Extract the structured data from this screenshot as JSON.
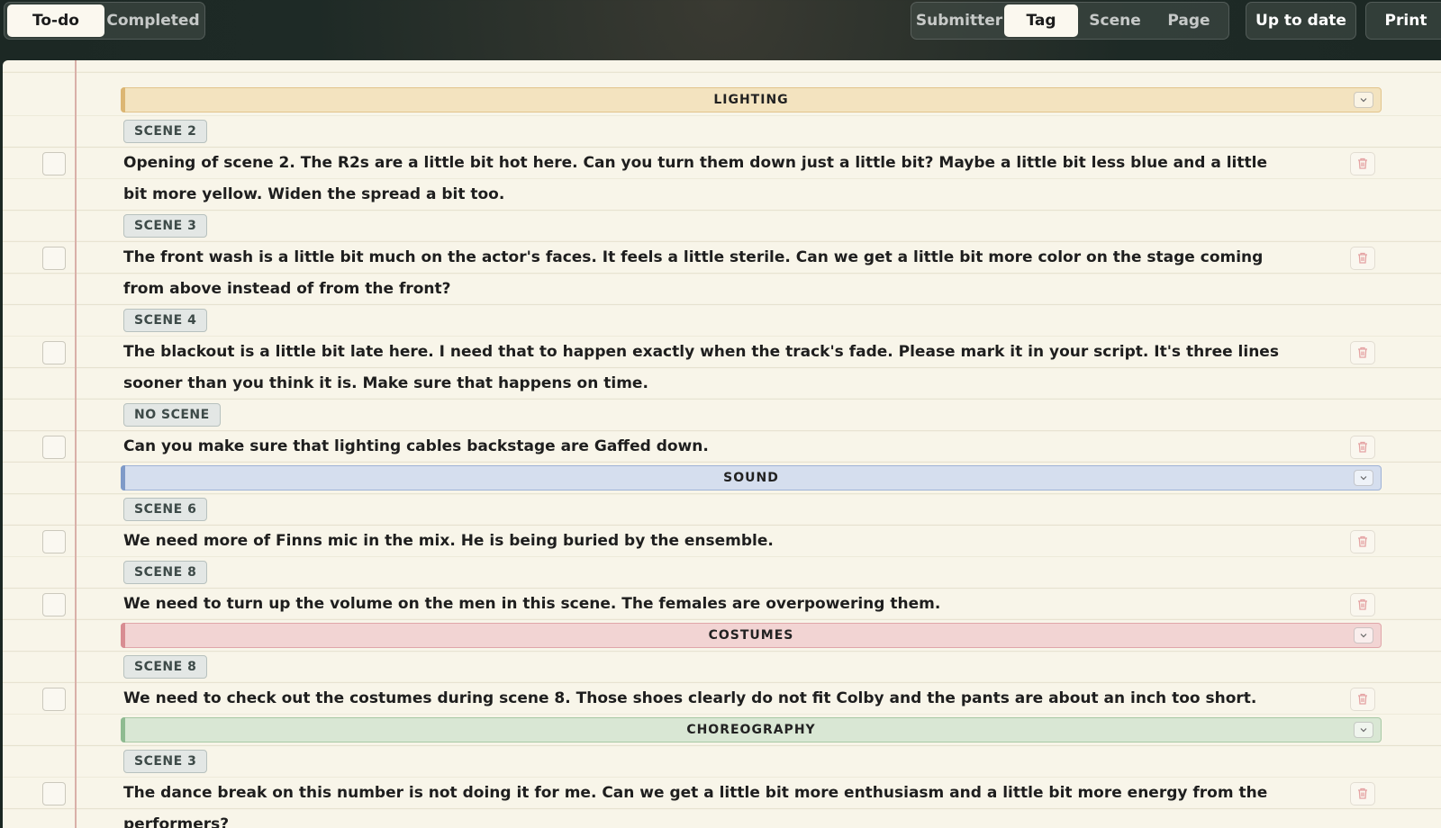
{
  "view_tabs": [
    {
      "label": "To-do",
      "active": true
    },
    {
      "label": "Completed",
      "active": false
    }
  ],
  "group_by": [
    {
      "label": "Submitter",
      "active": false
    },
    {
      "label": "Tag",
      "active": true
    },
    {
      "label": "Scene",
      "active": false
    },
    {
      "label": "Page",
      "active": false
    }
  ],
  "actions": {
    "up_to_date": "Up to date",
    "print": "Print"
  },
  "icons": {
    "collapse": "chevron-down-icon",
    "delete": "trash-icon"
  },
  "groups": [
    {
      "tag": "LIGHTING",
      "bar_color": "#dcb673",
      "bg_color": "#f3e3bf",
      "border_color": "#e2c48c",
      "scenes": [
        {
          "scene": "SCENE 2",
          "notes": [
            "Opening of scene 2. The R2s are a little bit hot here. Can you turn them down just a little bit? Maybe a little bit less blue and a little bit more yellow. Widen the spread a bit too."
          ]
        },
        {
          "scene": "SCENE 3",
          "notes": [
            "The front wash is a little bit much on the actor's faces. It feels a little sterile. Can we get a little bit more color on the stage coming from above instead of from the front?"
          ]
        },
        {
          "scene": "SCENE 4",
          "notes": [
            "The blackout is a little bit late here. I need that to happen exactly when the track's fade. Please mark it in your script. It's three lines sooner than you think it is. Make sure that happens on time."
          ]
        },
        {
          "scene": "NO SCENE",
          "notes": [
            "Can you make sure that lighting cables backstage are Gaffed down."
          ]
        }
      ]
    },
    {
      "tag": "SOUND",
      "bar_color": "#7f9ac8",
      "bg_color": "#d5deee",
      "border_color": "#9eb2d6",
      "scenes": [
        {
          "scene": "SCENE 6",
          "notes": [
            "We need more of Finns mic in the mix. He is being buried by the ensemble."
          ]
        },
        {
          "scene": "SCENE 8",
          "notes": [
            "We need to turn up the volume on the men in this scene. The females are overpowering them."
          ]
        }
      ]
    },
    {
      "tag": "COSTUMES",
      "bar_color": "#d88d92",
      "bg_color": "#f2d4d3",
      "border_color": "#e0a6a9",
      "scenes": [
        {
          "scene": "SCENE 8",
          "notes": [
            "We need to check out the costumes during scene 8. Those shoes clearly do not fit Colby and the pants are about an inch too short."
          ]
        }
      ]
    },
    {
      "tag": "CHOREOGRAPHY",
      "bar_color": "#8fbb91",
      "bg_color": "#d9e7d4",
      "border_color": "#a8c9a5",
      "scenes": [
        {
          "scene": "SCENE 3",
          "notes": [
            "The dance break on this number is not doing it for me. Can we get a little bit more enthusiasm and a little bit more energy from the performers?"
          ]
        }
      ]
    }
  ]
}
